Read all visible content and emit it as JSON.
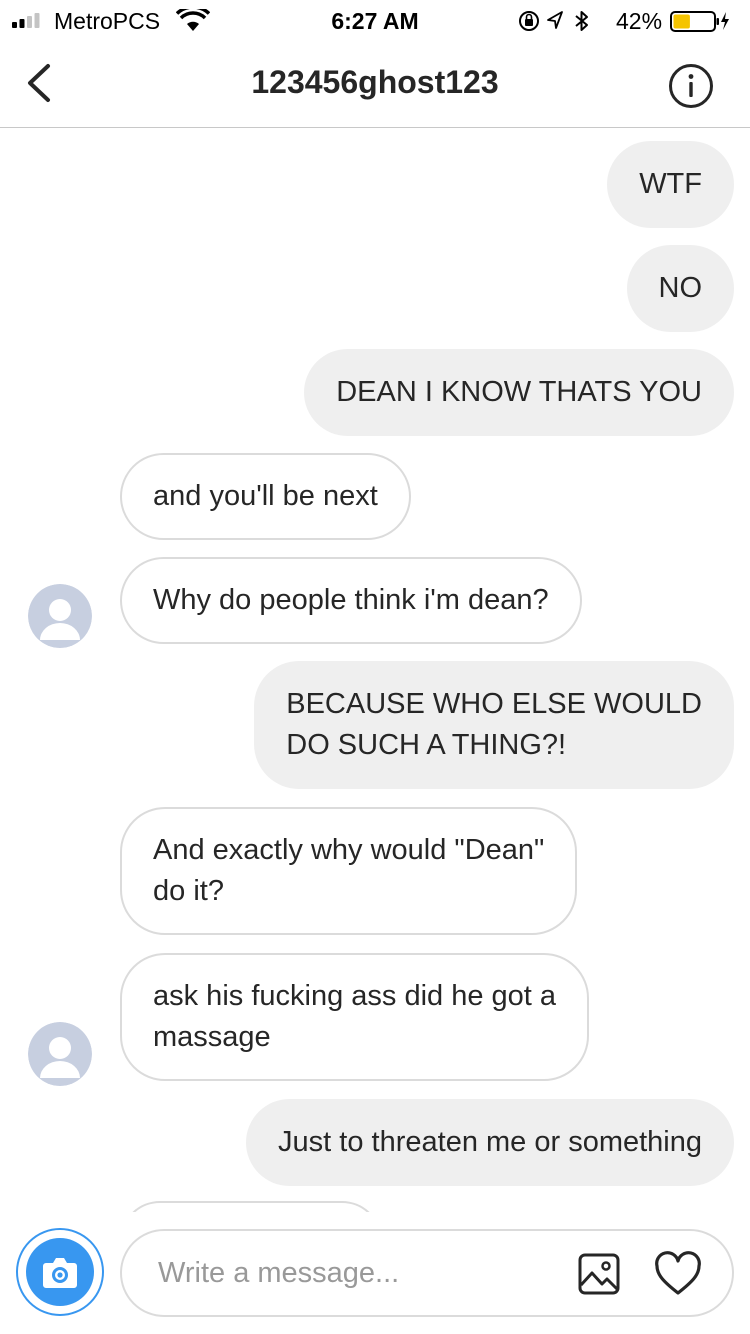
{
  "status_bar": {
    "carrier": "MetroPCS",
    "time": "6:27 AM",
    "battery_percent": "42%",
    "battery_level": 0.42,
    "icons": [
      "signal-icon",
      "wifi-icon",
      "orientation-lock-icon",
      "location-icon",
      "bluetooth-icon",
      "battery-icon",
      "charging-icon"
    ]
  },
  "nav": {
    "title": "123456ghost123",
    "back_icon": "chevron-left-icon",
    "info_icon": "info-icon"
  },
  "messages": [
    {
      "direction": "out",
      "text": "WTF"
    },
    {
      "direction": "out",
      "text": "NO"
    },
    {
      "direction": "out",
      "text": "DEAN I KNOW THATS YOU"
    },
    {
      "direction": "in",
      "text": "and you'll be next"
    },
    {
      "direction": "in",
      "text": "Why do people think i'm dean?",
      "avatar": true
    },
    {
      "direction": "out",
      "text": "BECAUSE WHO ELSE WOULD\nDO SUCH A THING?!"
    },
    {
      "direction": "in",
      "text": "And exactly why would \"Dean\"\ndo it?"
    },
    {
      "direction": "in",
      "text": "ask his fucking ass did he got a\nmassage",
      "avatar": true
    },
    {
      "direction": "out",
      "text": "Just to threaten me or something"
    }
  ],
  "composer": {
    "placeholder": "Write a message...",
    "value": "",
    "camera_icon": "camera-icon",
    "gallery_icon": "image-gallery-icon",
    "heart_icon": "heart-icon",
    "accent_color": "#3897f0"
  },
  "colors": {
    "outgoing_bubble": "#efefef",
    "incoming_border": "#dbdbdb",
    "battery_fill": "#f5c400"
  }
}
